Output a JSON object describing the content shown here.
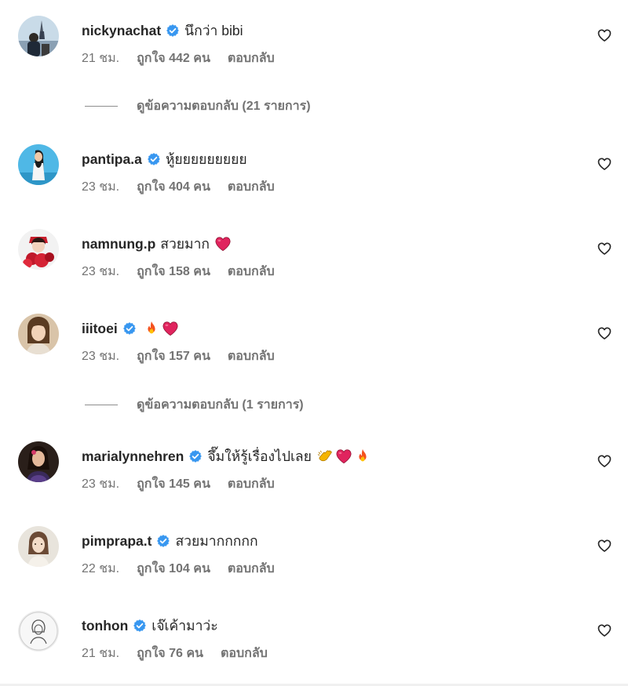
{
  "icons": {
    "verified": "verified-badge-icon",
    "like": "heart-outline-icon"
  },
  "colors": {
    "verified": "#3897f0",
    "meta": "#737373",
    "text": "#262626"
  },
  "comments": [
    {
      "username": "nickynachat",
      "verified": true,
      "text": "นึกว่า bibi",
      "emojis": [],
      "time": "21 ชม.",
      "likes": "ถูกใจ 442 คน",
      "reply": "ตอบกลับ"
    },
    {
      "username": "pantipa.a",
      "verified": true,
      "text": "หู้ยยยยยยยยย",
      "emojis": [],
      "time": "23 ชม.",
      "likes": "ถูกใจ 404 คน",
      "reply": "ตอบกลับ"
    },
    {
      "username": "namnung.p",
      "verified": false,
      "text": "สวยมาก",
      "emojis": [
        "red-heart"
      ],
      "time": "23 ชม.",
      "likes": "ถูกใจ 158 คน",
      "reply": "ตอบกลับ"
    },
    {
      "username": "iiitoei",
      "verified": true,
      "text": "",
      "emojis": [
        "fire",
        "red-heart"
      ],
      "time": "23 ชม.",
      "likes": "ถูกใจ 157 คน",
      "reply": "ตอบกลับ"
    },
    {
      "username": "marialynnehren",
      "verified": true,
      "text": "จึ๊มให้รู้เรื่องไปเลย",
      "emojis": [
        "clapping-hands",
        "red-heart",
        "fire"
      ],
      "time": "23 ชม.",
      "likes": "ถูกใจ 145 คน",
      "reply": "ตอบกลับ"
    },
    {
      "username": "pimprapa.t",
      "verified": true,
      "text": "สวยมากกกกก",
      "emojis": [],
      "time": "22 ชม.",
      "likes": "ถูกใจ 104 คน",
      "reply": "ตอบกลับ"
    },
    {
      "username": "tonhon",
      "verified": true,
      "text": "เจ๊เค้ามาว่ะ",
      "emojis": [],
      "time": "21 ชม.",
      "likes": "ถูกใจ 76 คน",
      "reply": "ตอบกลับ"
    }
  ],
  "view_replies": [
    {
      "label": "ดูข้อความตอบกลับ (21 รายการ)"
    },
    {
      "label": "ดูข้อความตอบกลับ (1 รายการ)"
    }
  ]
}
